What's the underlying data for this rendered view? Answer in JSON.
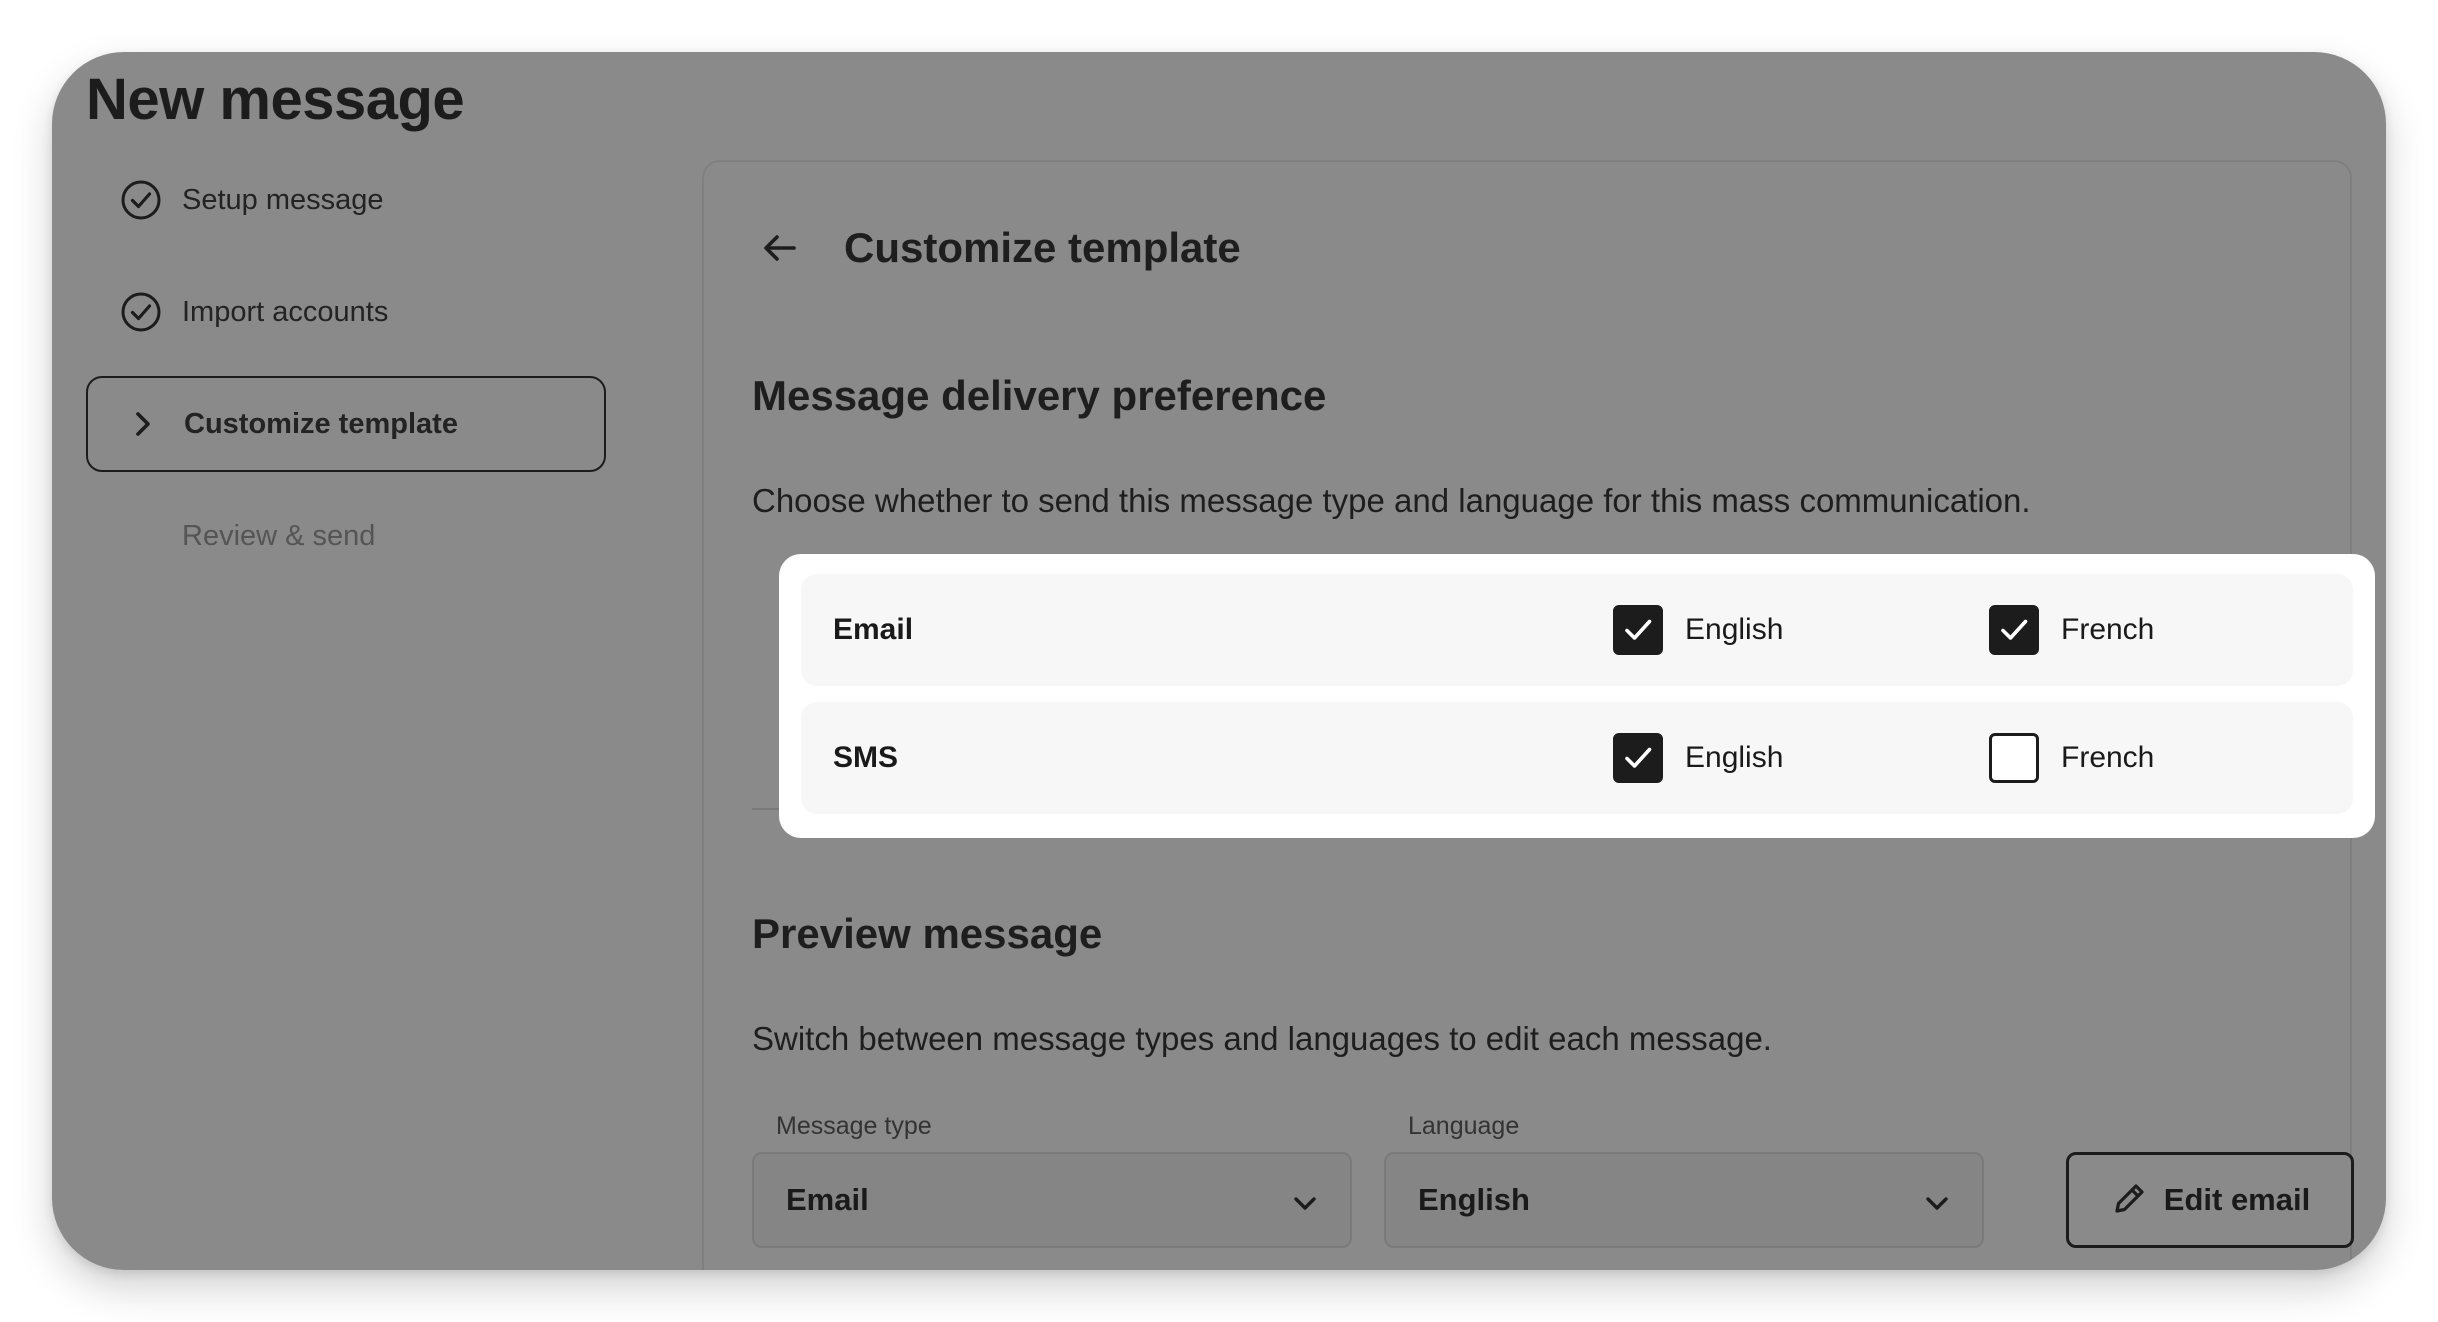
{
  "page": {
    "title": "New message"
  },
  "stepper": {
    "steps": [
      {
        "label": "Setup message",
        "status": "complete",
        "icon": "check-circle-icon"
      },
      {
        "label": "Import accounts",
        "status": "complete",
        "icon": "check-circle-icon"
      },
      {
        "label": "Customize template",
        "status": "current",
        "icon": "chevron-right-icon"
      },
      {
        "label": "Review & send",
        "status": "pending"
      }
    ]
  },
  "panel": {
    "back_icon": "arrow-left-icon",
    "title": "Customize template",
    "delivery": {
      "heading": "Message delivery preference",
      "description": "Choose whether to send this message type and language for this mass communication.",
      "rows": [
        {
          "label": "Email",
          "options": [
            {
              "label": "English",
              "checked": true
            },
            {
              "label": "French",
              "checked": true
            }
          ]
        },
        {
          "label": "SMS",
          "options": [
            {
              "label": "English",
              "checked": true
            },
            {
              "label": "French",
              "checked": false
            }
          ]
        }
      ]
    },
    "preview": {
      "heading": "Preview message",
      "description": "Switch between message types and languages to edit each message.",
      "message_type": {
        "label": "Message type",
        "value": "Email"
      },
      "language": {
        "label": "Language",
        "value": "English"
      },
      "edit_button": {
        "label": "Edit email",
        "icon": "pencil-icon"
      }
    }
  },
  "colors": {
    "overlay": "#8a8a8a",
    "text": "#1c1c1c",
    "highlight_card": "#ffffff",
    "checkbox_checked": "#1c1c1c"
  }
}
